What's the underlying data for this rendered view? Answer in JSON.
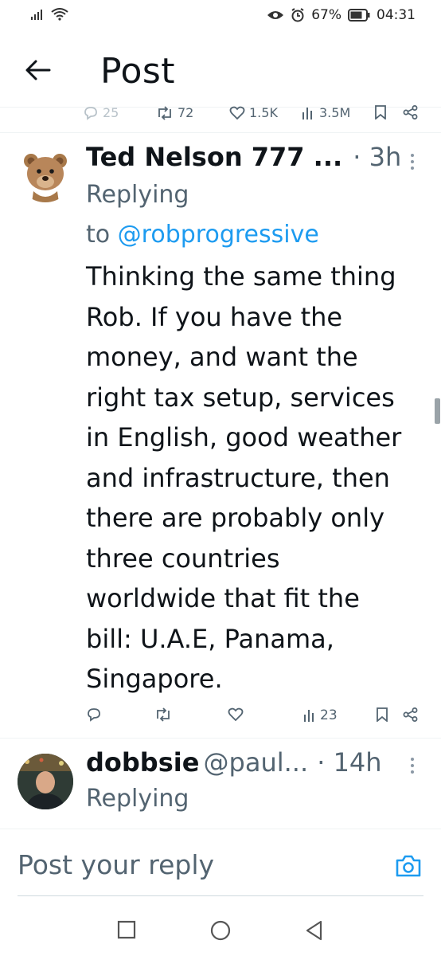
{
  "status_bar": {
    "battery": "67%",
    "time": "04:31"
  },
  "header": {
    "title": "Post"
  },
  "top_actions": {
    "replies": "25",
    "reposts": "72",
    "likes": "1.5K",
    "views": "3.5M"
  },
  "replies": [
    {
      "name": "Ted Nelson 777 ...",
      "time": "· 3h",
      "replying_prefix": "Replying",
      "replying_to": "to",
      "mention": "@robprogressive",
      "body_lines": [
        "Thinking the same thing",
        "Rob. If you have the",
        "money, and want the",
        "right tax setup, services",
        "in English, good weather",
        "and infrastructure, then",
        "there are probably only",
        "three countries",
        "worldwide that fit the",
        "bill: U.A.E, Panama,",
        "Singapore."
      ],
      "views": "23"
    },
    {
      "name": "dobbsie",
      "handle": "@paul...",
      "time": "· 14h",
      "replying_prefix": "Replying"
    }
  ],
  "compose": {
    "placeholder": "Post your reply"
  },
  "icons": {
    "back": "arrow-left-icon",
    "camera": "camera-icon",
    "reply": "reply-icon",
    "repost": "repost-icon",
    "like": "heart-icon",
    "views": "views-icon",
    "bookmark": "bookmark-icon",
    "share": "share-icon"
  },
  "colors": {
    "link": "#1d9bf0",
    "muted": "#536471"
  }
}
